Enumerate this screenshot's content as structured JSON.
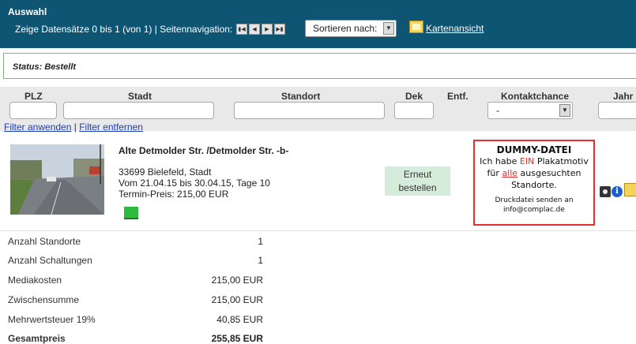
{
  "header": {
    "title": "Auswahl",
    "records_info": "Zeige Datensätze 0 bis 1 (von 1) | Seitennavigation:",
    "nav_buttons": [
      "first",
      "previous",
      "next",
      "last"
    ],
    "sort_label": "Sortieren nach:",
    "map_view_label": "Kartenansicht",
    "background_color": "#0e5574"
  },
  "status": {
    "label": "Status: Bestellt"
  },
  "filters": {
    "columns": {
      "plz": "PLZ",
      "stadt": "Stadt",
      "standort": "Standort",
      "dek": "Dek",
      "entf": "Entf.",
      "kontaktchance": "Kontaktchance",
      "jahr": "Jahr"
    },
    "kontaktchance_value": "-",
    "apply_label": "Filter anwenden",
    "separator": "|",
    "remove_label": "Filter entfernen"
  },
  "record": {
    "title": "Alte Detmolder Str. /Detmolder Str. -b-",
    "city": "33699 Bielefeld, Stadt",
    "period": "Vom 21.04.15 bis 30.04.15, Tage 10",
    "price": "Termin-Preis: 215,00 EUR",
    "reorder_line1": "Erneut",
    "reorder_line2": "bestellen"
  },
  "dummy_notice": {
    "title": "DUMMY-DATEI",
    "line1_pre": "Ich habe ",
    "line1_em": "EIN",
    "line1_post": " Plakatmotiv",
    "line2_pre": "für ",
    "line2_em": "alle",
    "line2_post": " ausgesuchten",
    "line3": "Standorte.",
    "line4": "Druckdatei senden an",
    "line5": "info@complac.de",
    "accent_color": "#e03030"
  },
  "summary": {
    "rows": [
      {
        "label": "Anzahl Standorte",
        "value": "1"
      },
      {
        "label": "Anzahl Schaltungen",
        "value": "1"
      },
      {
        "label": "Mediakosten",
        "value": "215,00 EUR"
      },
      {
        "label": "Zwischensumme",
        "value": "215,00 EUR"
      },
      {
        "label": "Mehrwertsteuer 19%",
        "value": "40,85 EUR"
      },
      {
        "label": "Gesamtpreis",
        "value": "255,85 EUR"
      }
    ]
  },
  "icons": [
    "camera-icon",
    "info-icon",
    "map-icon"
  ]
}
